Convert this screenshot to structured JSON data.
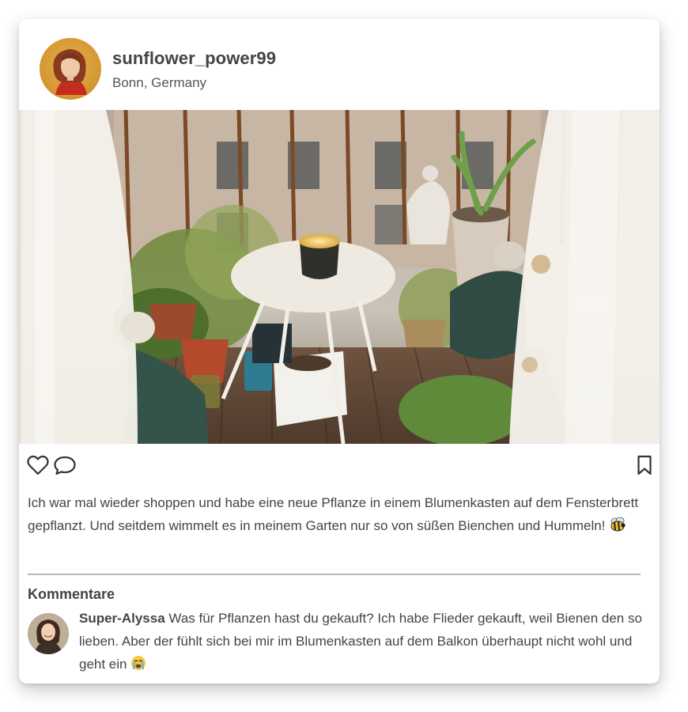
{
  "post": {
    "username": "sunflower_power99",
    "location": "Bonn, Germany",
    "caption": "Ich war mal wieder shoppen und habe eine neue Pflanze in einem Blumenkasten auf dem Fensterbrett gepflanzt. Und seitdem wimmelt es in meinem Garten nur so von süßen Bienchen und Hummeln!",
    "caption_emoji": "bee-emoji",
    "photo_subject": "Balkon mit Pflanzen, kleinem Tisch und Kerze"
  },
  "actions": {
    "like_icon": "heart-icon",
    "comment_icon": "comment-icon",
    "save_icon": "bookmark-icon"
  },
  "comments": {
    "title": "Kommentare",
    "items": [
      {
        "author": "Super-Alyssa",
        "text": "Was für Pflanzen hast du gekauft? Ich habe Flieder gekauft, weil Bienen den so lieben. Aber der fühlt sich bei mir im Blumenkasten auf dem Balkon überhaupt nicht wohl und geht ein",
        "emoji": "crying-face-emoji"
      }
    ]
  },
  "colors": {
    "card_background": "#ffffff",
    "text": "#444444",
    "divider": "#b9b9b9",
    "avatar_background": "#d69a35"
  }
}
